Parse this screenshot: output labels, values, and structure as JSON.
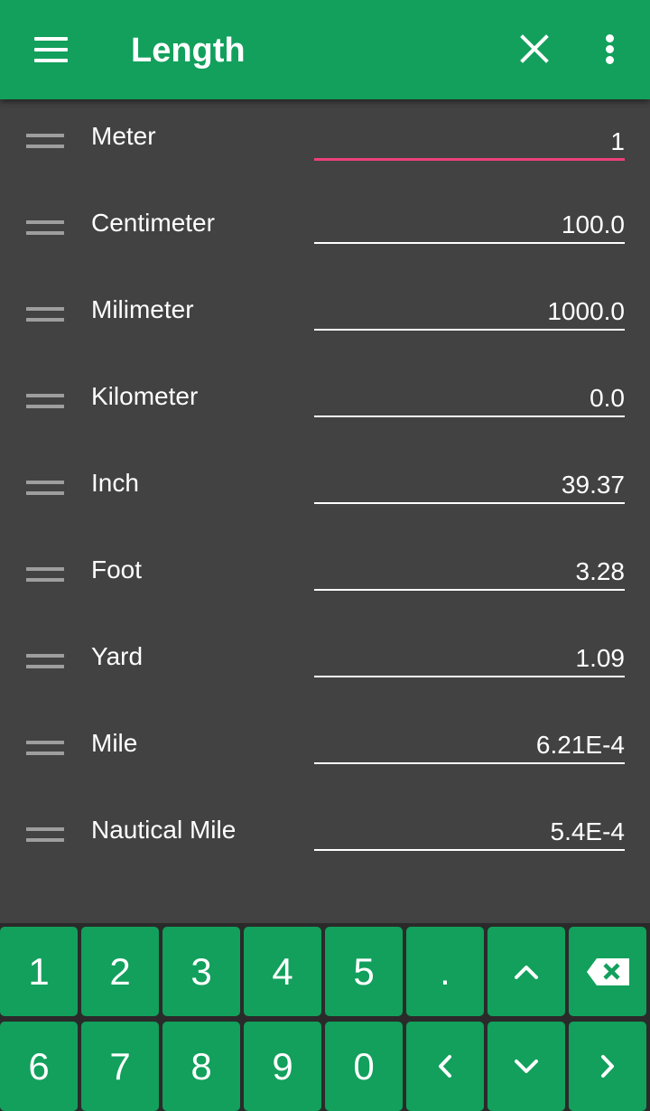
{
  "colors": {
    "primary": "#12a05c",
    "background": "#424242",
    "active_underline": "#ec407a"
  },
  "appbar": {
    "title": "Length",
    "menu_icon": "hamburger-menu-icon",
    "close_icon": "close-icon",
    "more_icon": "more-vert-icon"
  },
  "units": [
    {
      "label": "Meter",
      "value": "1",
      "active": true
    },
    {
      "label": "Centimeter",
      "value": "100.0"
    },
    {
      "label": "Milimeter",
      "value": "1000.0"
    },
    {
      "label": "Kilometer",
      "value": "0.0"
    },
    {
      "label": "Inch",
      "value": "39.37"
    },
    {
      "label": "Foot",
      "value": "3.28"
    },
    {
      "label": "Yard",
      "value": "1.09"
    },
    {
      "label": "Mile",
      "value": "6.21E-4"
    },
    {
      "label": "Nautical Mile",
      "value": "5.4E-4"
    }
  ],
  "keypad": {
    "row1": [
      "1",
      "2",
      "3",
      "4",
      "5",
      "."
    ],
    "row2": [
      "6",
      "7",
      "8",
      "9",
      "0"
    ],
    "icons": {
      "up": "chevron-up-icon",
      "backspace": "backspace-icon",
      "left": "chevron-left-icon",
      "down": "chevron-down-icon",
      "right": "chevron-right-icon"
    }
  }
}
